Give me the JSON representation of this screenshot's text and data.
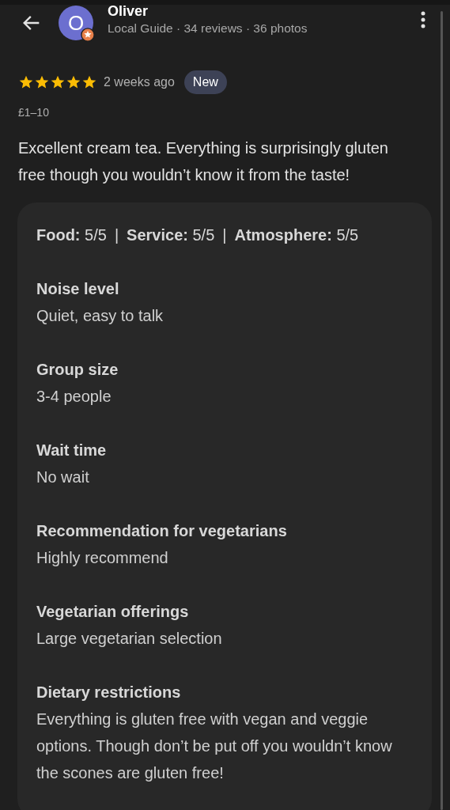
{
  "header": {
    "avatar_letter": "O",
    "name": "Oliver",
    "subtitle": "Local Guide · 34 reviews · 36 photos"
  },
  "review": {
    "stars": 5,
    "time": "2 weeks ago",
    "badge": "New",
    "price": "£1–10",
    "text": "Excellent cream tea. Everything is surprisingly gluten free though you wouldn’t know it from the taste!"
  },
  "details": {
    "ratings": [
      "**Food:** 5/5",
      "**Service:** 5/5",
      "**Atmosphere:** 5/5"
    ],
    "separator": "|",
    "items": [
      {
        "label": "Noise level",
        "value": "Quiet, easy to talk"
      },
      {
        "label": "Group size",
        "value": "3-4 people"
      },
      {
        "label": "Wait time",
        "value": "No wait"
      },
      {
        "label": "Recommendation for vegetarians",
        "value": "Highly recommend"
      },
      {
        "label": "Vegetarian offerings",
        "value": "Large vegetarian selection"
      },
      {
        "label": "Dietary restrictions",
        "value": "Everything is gluten free with vegan and veggie options. Though don’t be put off you wouldn’t know the scones are gluten free!"
      }
    ]
  }
}
